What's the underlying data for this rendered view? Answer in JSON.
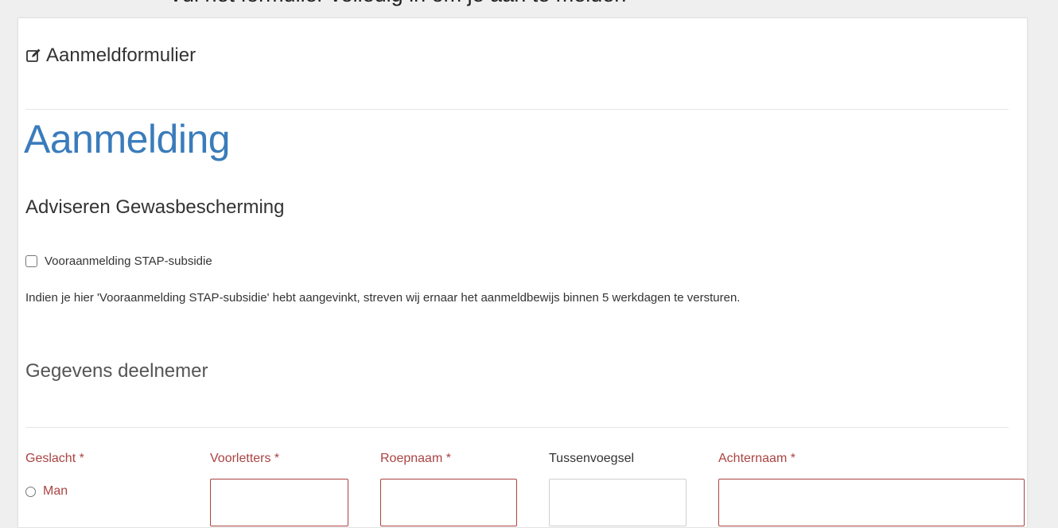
{
  "top_strip": {
    "text": "Vul het formulier volledig in om je aan te melden"
  },
  "panel": {
    "heading": "Aanmeldformulier",
    "heading_icon": "edit-icon"
  },
  "form": {
    "title": "Aanmelding",
    "subtitle": "Adviseren Gewasbescherming",
    "pre_registration": {
      "label": "Vooraanmelding STAP-subsidie",
      "checked": false
    },
    "info_text": "Indien je hier 'Vooraanmelding STAP-subsidie' hebt aangevinkt, streven wij ernaar het aanmeldbewijs binnen 5 werkdagen te versturen.",
    "section_title": "Gegevens deelnemer",
    "fields": {
      "gender": {
        "label": "Geslacht *",
        "options": [
          "Man"
        ]
      },
      "initials": {
        "label": "Voorletters *",
        "value": ""
      },
      "first_name": {
        "label": "Roepnaam *",
        "value": ""
      },
      "prefix": {
        "label": "Tussenvoegsel",
        "value": ""
      },
      "last_name": {
        "label": "Achternaam *",
        "value": ""
      }
    }
  },
  "colors": {
    "background": "#efefef",
    "panel": "#ffffff",
    "title_blue": "#3a7cbb",
    "required_red": "#a94442",
    "border_grey": "#e6e6e6"
  }
}
